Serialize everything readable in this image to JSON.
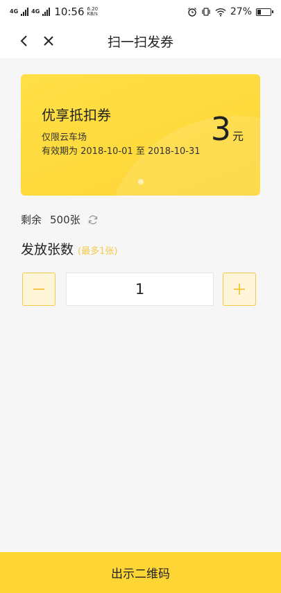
{
  "status_bar": {
    "network_1": "4G",
    "network_2": "4G",
    "time": "10:56",
    "speed_value": "6.20",
    "speed_unit": "KB/s",
    "battery_percent": "27%",
    "battery_level": 0.27,
    "icons": [
      "alarm-icon",
      "vibrate-icon",
      "wifi-icon",
      "battery-icon"
    ]
  },
  "navbar": {
    "title": "扫一扫发券",
    "back_icon": "chevron-left-icon",
    "close_icon": "close-icon"
  },
  "coupon": {
    "title": "优享抵扣券",
    "venue": "仅限云车场",
    "validity": "有效期为 2018-10-01 至 2018-10-31",
    "amount": "3",
    "unit": "元"
  },
  "remaining": {
    "label": "剩余",
    "count": "500张",
    "refresh_icon": "refresh-icon"
  },
  "issue": {
    "label": "发放张数",
    "limit": "(最多1张)"
  },
  "stepper": {
    "value": "1",
    "minus_icon": "minus-icon",
    "plus_icon": "plus-icon"
  },
  "bottom": {
    "button_label": "出示二维码"
  },
  "colors": {
    "accent": "#fdd535",
    "accent_text": "#f5c84a",
    "background": "#f6f6f6"
  }
}
